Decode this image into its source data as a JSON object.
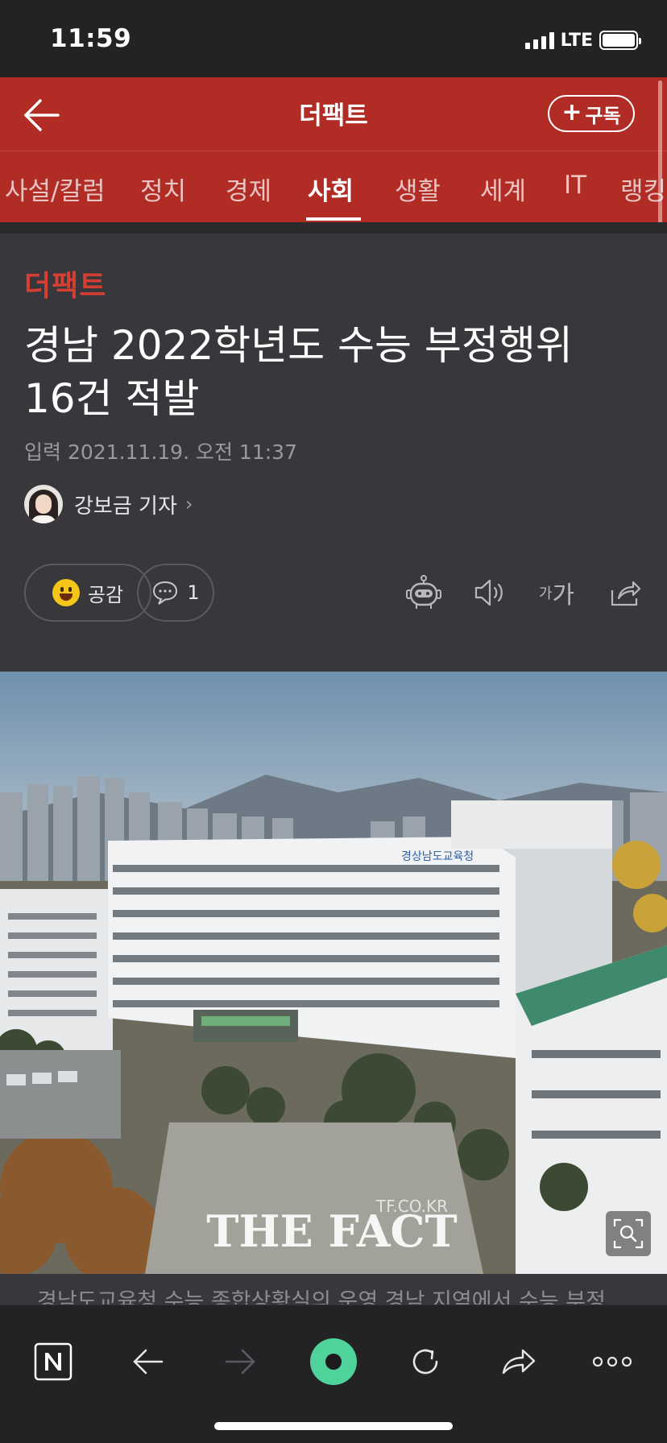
{
  "status_bar": {
    "time": "11:59",
    "network": "LTE"
  },
  "header": {
    "title": "더팩트",
    "subscribe_label": "구독"
  },
  "tabs": [
    {
      "label": "사설/칼럼"
    },
    {
      "label": "정치"
    },
    {
      "label": "경제"
    },
    {
      "label": "사회",
      "active": true
    },
    {
      "label": "생활"
    },
    {
      "label": "세계"
    },
    {
      "label": "IT"
    },
    {
      "label": "랭킹"
    }
  ],
  "article": {
    "press_name": "더팩트",
    "title_line1": "경남 2022학년도 수능 부정행위",
    "title_line2": "16건 적발",
    "date": "입력 2021.11.19. 오전 11:37",
    "author": "강보금 기자",
    "empathy_label": "공감",
    "comment_count": "1",
    "font_size_label_small": "가",
    "font_size_label_large": "가",
    "body_peek": "경남도교육청 수능 종합상황실의 운영 경남 지역에서 수능 부정"
  },
  "photo": {
    "watermark_site": "TF.CO.KR",
    "watermark_brand": "THE FACT",
    "building_sign": "경상남도교육청"
  },
  "colors": {
    "brand": "#b02c25",
    "press_logo": "#d63d33",
    "toolbar_accent": "#4fd39a"
  },
  "toolbar_icons": [
    "naver-n-icon",
    "back-arrow-icon",
    "forward-arrow-icon",
    "green-dot-icon",
    "refresh-icon",
    "share-icon",
    "more-icon"
  ]
}
